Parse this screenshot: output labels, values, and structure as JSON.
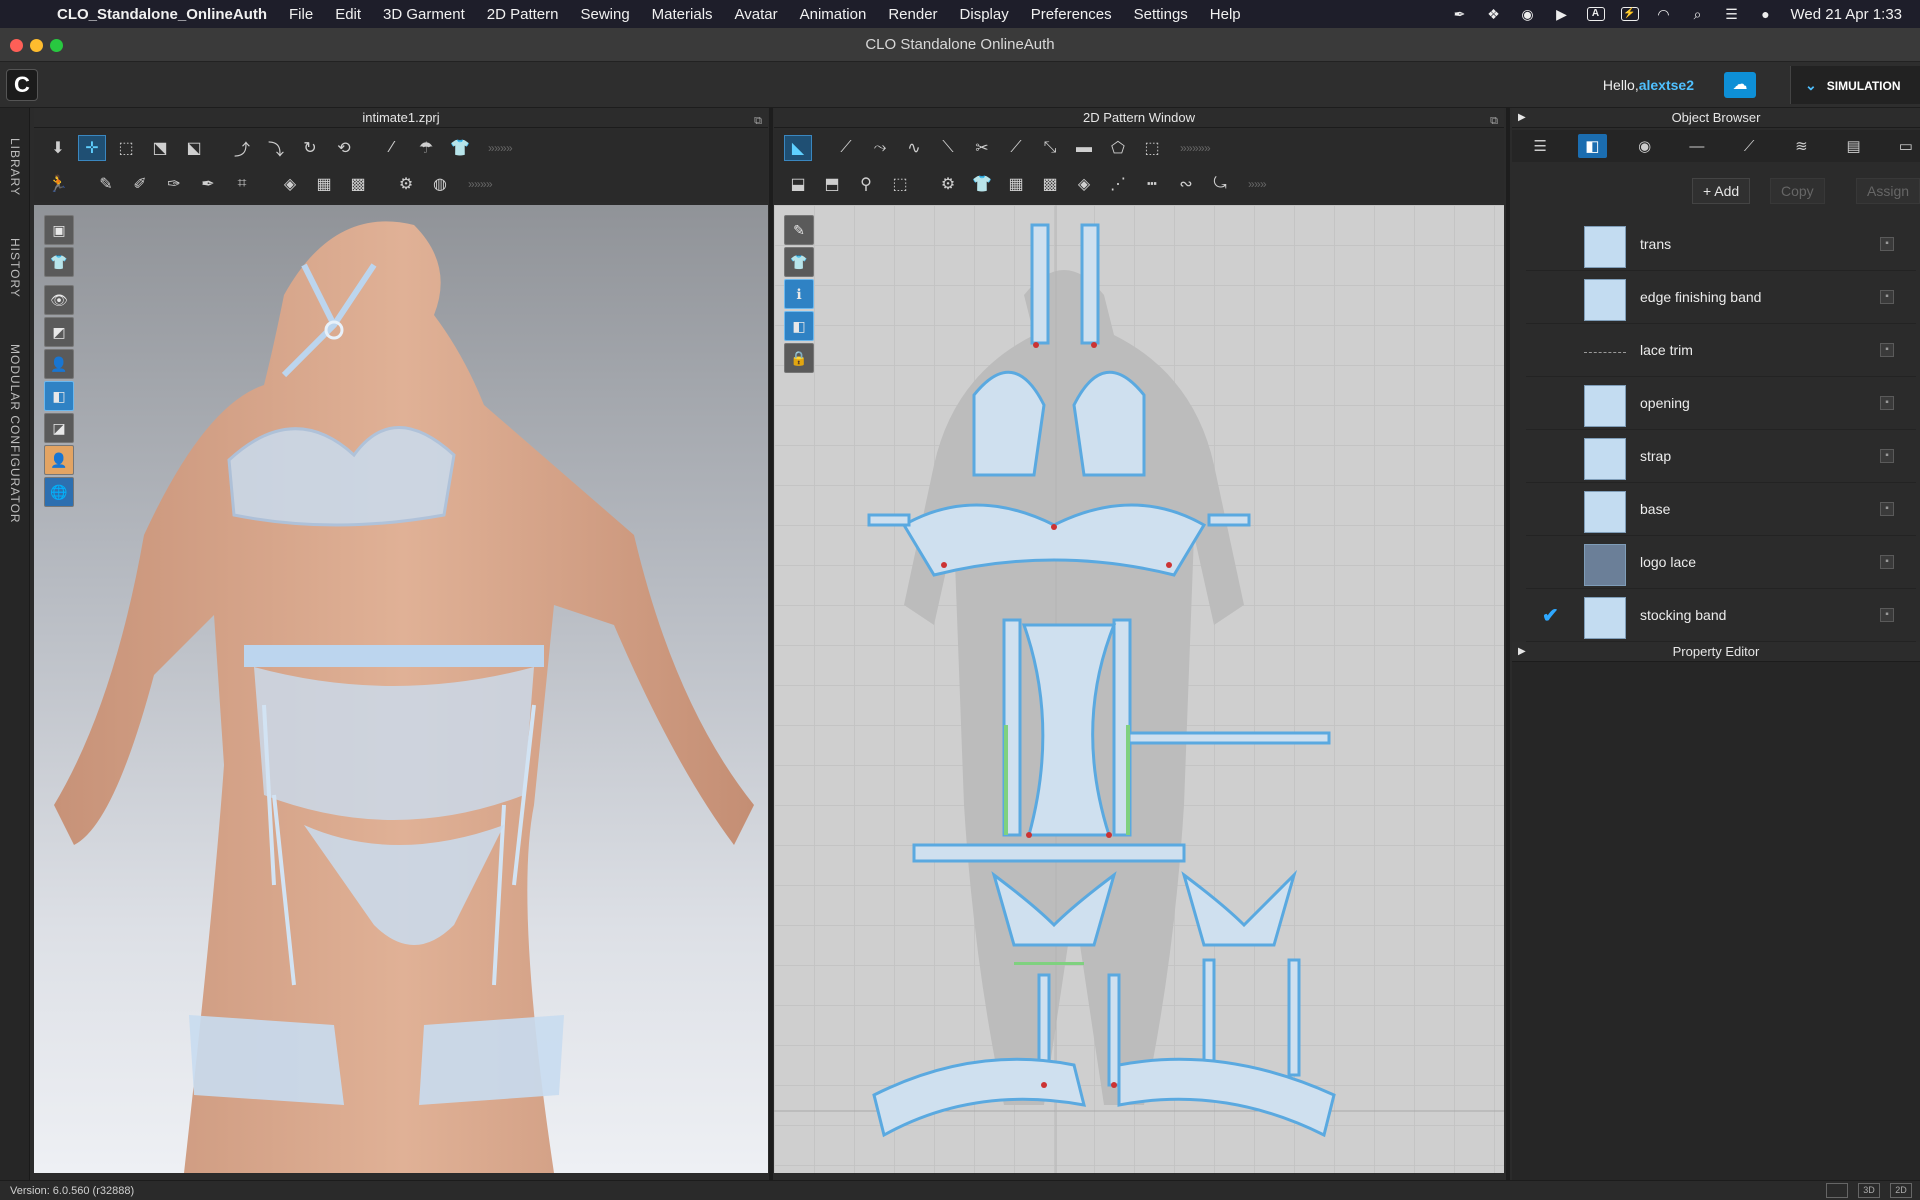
{
  "menubar": {
    "app_name": "CLO_Standalone_OnlineAuth",
    "items": [
      "File",
      "Edit",
      "3D Garment",
      "2D Pattern",
      "Sewing",
      "Materials",
      "Avatar",
      "Animation",
      "Render",
      "Display",
      "Preferences",
      "Settings",
      "Help"
    ],
    "status_icons": [
      "feather-icon",
      "dropbox-icon",
      "creative-cloud-icon",
      "play-icon",
      "text-input-icon",
      "battery-icon",
      "wifi-icon",
      "search-icon",
      "control-center-icon",
      "siri-icon"
    ],
    "clock": "Wed 21 Apr  1:33"
  },
  "window": {
    "title": "CLO Standalone OnlineAuth"
  },
  "header": {
    "hello_prefix": "Hello,",
    "username": "alextse2",
    "mode_label": "SIMULATION"
  },
  "side_tabs": [
    "LIBRARY",
    "HISTORY",
    "MODULAR CONFIGURATOR"
  ],
  "view3d": {
    "title": "intimate1.zprj"
  },
  "view2d": {
    "title": "2D Pattern Window"
  },
  "object_browser": {
    "title": "Object Browser",
    "add_label": "+ Add",
    "copy_label": "Copy",
    "assign_label": "Assign",
    "fabrics": [
      {
        "name": "trans",
        "swatch": "plain",
        "checked": false
      },
      {
        "name": "edge finishing band",
        "swatch": "plain",
        "checked": false
      },
      {
        "name": "lace trim",
        "swatch": "line",
        "checked": false
      },
      {
        "name": "opening",
        "swatch": "plain",
        "checked": false
      },
      {
        "name": "strap",
        "swatch": "plain",
        "checked": false
      },
      {
        "name": "base",
        "swatch": "plain",
        "checked": false
      },
      {
        "name": "logo lace",
        "swatch": "lace",
        "checked": false
      },
      {
        "name": "stocking band",
        "swatch": "plain",
        "checked": true
      }
    ]
  },
  "property_editor": {
    "title": "Property Editor"
  },
  "status": {
    "version": "Version: 6.0.560 (r32888)",
    "view_buttons": [
      "",
      "3D",
      "2D"
    ]
  },
  "colors": {
    "accent": "#1b6db0",
    "fabric": "#c3dcf1",
    "pattern_edge": "#5aa9e0",
    "username": "#4fc0ff"
  }
}
